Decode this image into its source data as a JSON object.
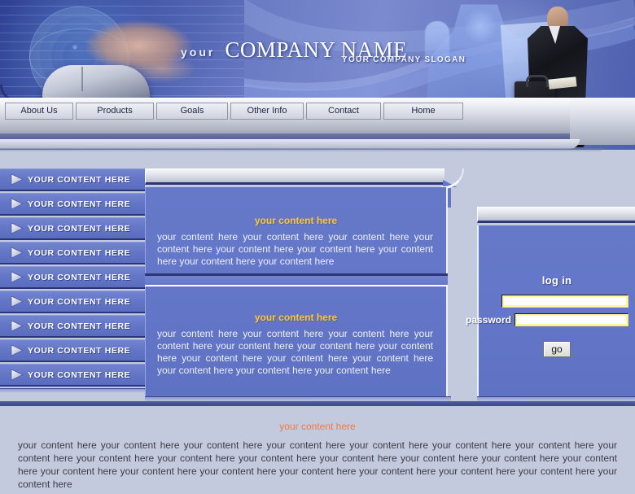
{
  "header": {
    "your_word": "your",
    "company_name": "COMPANY NAME",
    "slogan": "YOUR COMPANY SLOGAN"
  },
  "nav": {
    "items": [
      {
        "label": "About Us"
      },
      {
        "label": "Products"
      },
      {
        "label": "Goals"
      },
      {
        "label": "Other Info"
      },
      {
        "label": "Contact"
      },
      {
        "label": "Home"
      }
    ]
  },
  "sidebar": {
    "items": [
      {
        "label": "YOUR CONTENT HERE",
        "icon": "arrow-right-icon"
      },
      {
        "label": "YOUR CONTENT HERE",
        "icon": "arrow-right-icon"
      },
      {
        "label": "YOUR CONTENT HERE",
        "icon": "arrow-right-icon"
      },
      {
        "label": "YOUR CONTENT HERE",
        "icon": "arrow-right-icon"
      },
      {
        "label": "YOUR CONTENT HERE",
        "icon": "arrow-right-icon"
      },
      {
        "label": "YOUR CONTENT HERE",
        "icon": "arrow-right-icon"
      },
      {
        "label": "YOUR CONTENT HERE",
        "icon": "arrow-right-icon"
      },
      {
        "label": "YOUR CONTENT HERE",
        "icon": "arrow-right-icon"
      },
      {
        "label": "YOUR CONTENT HERE",
        "icon": "arrow-right-icon"
      }
    ]
  },
  "main": {
    "section_one": {
      "title": "your content here",
      "body": "your content here your content here your content here your content here your content here your content here your content here your content here your content here"
    },
    "section_two": {
      "title": "your content here",
      "body": "your content here your content here your content here your content here your content here your content here your content here your content here your content here your content here your content here your content here your content here"
    }
  },
  "login": {
    "title": "log in",
    "username_value": "",
    "username_placeholder": "",
    "password_label": "password",
    "password_value": "",
    "password_placeholder": "",
    "go_label": "go"
  },
  "footer": {
    "title": "your content here",
    "body": "your content here your content here your content here your content here your content here your content here your content here your content here your content here your content here your content here your content here your content here your content here your content here your content here your content here your content here your content here your content here your content here your content here your content here"
  },
  "colors": {
    "panel_blue": "#6376c7",
    "page_bg": "#c4cadd",
    "accent_gold": "#ffc734",
    "accent_orange": "#ef7a44",
    "nav_text": "#1b2340",
    "dark_blue": "#2c3678"
  }
}
